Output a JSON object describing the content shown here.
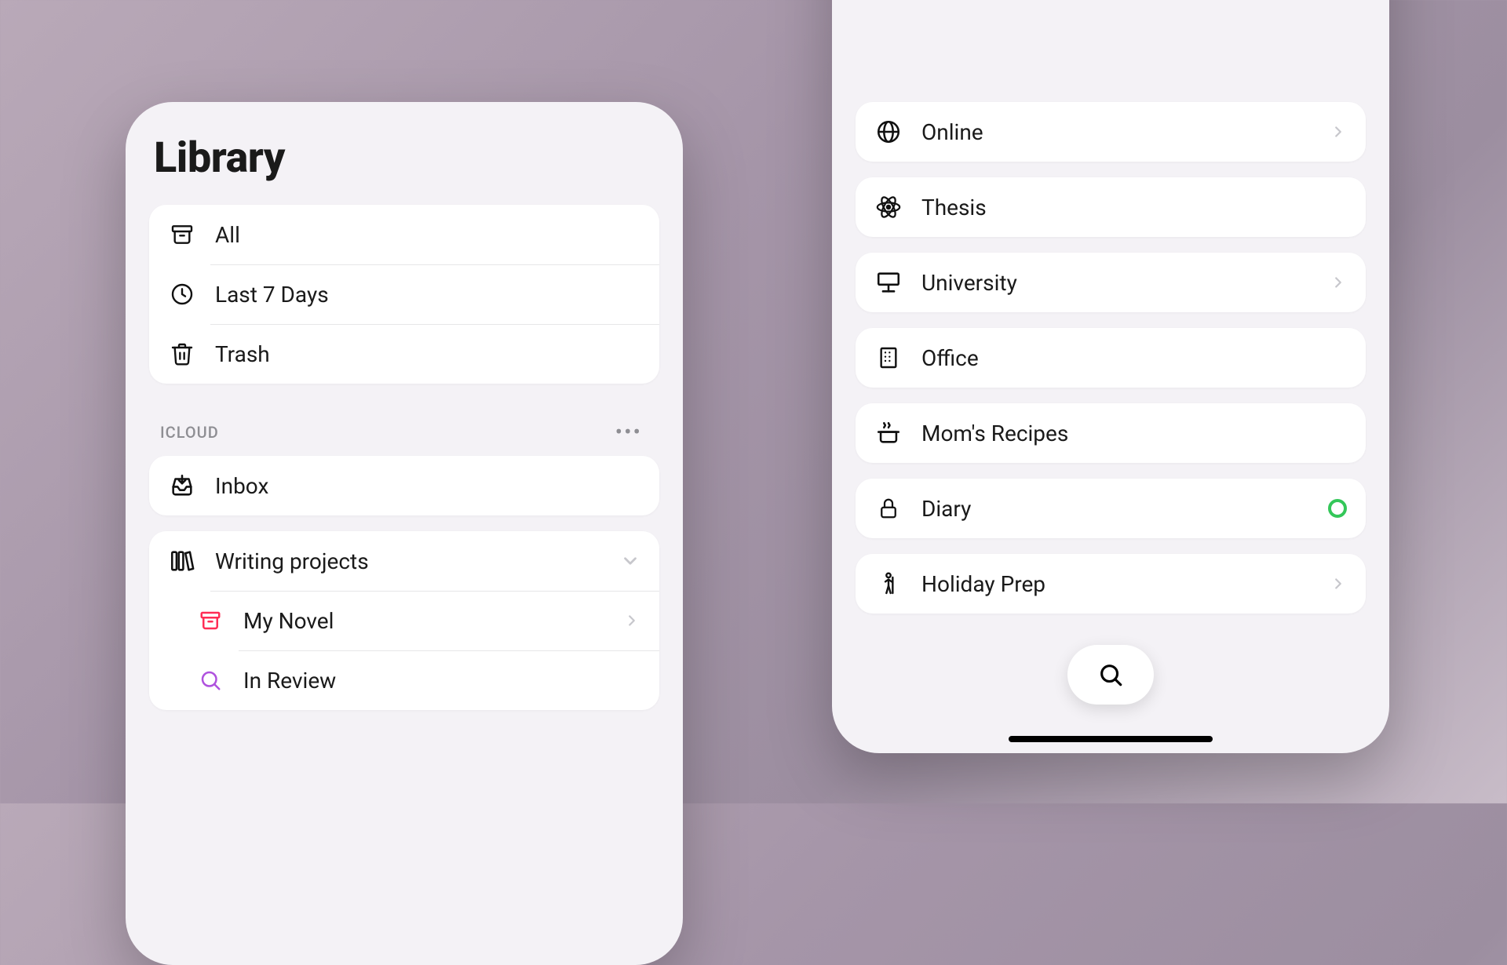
{
  "left": {
    "title": "Library",
    "system_items": [
      {
        "icon": "archive",
        "label": "All"
      },
      {
        "icon": "clock",
        "label": "Last 7 Days"
      },
      {
        "icon": "trash",
        "label": "Trash"
      }
    ],
    "cloud_section": {
      "header": "ICLOUD",
      "inbox_label": "Inbox",
      "group_label": "Writing projects",
      "children": [
        {
          "icon": "archive",
          "label": "My Novel",
          "color": "accent",
          "chevron": true
        },
        {
          "icon": "search",
          "label": "In Review",
          "color": "purple",
          "chevron": false
        }
      ]
    }
  },
  "right": {
    "items": [
      {
        "icon": "globe",
        "label": "Online",
        "chevron": true
      },
      {
        "icon": "atom",
        "label": "Thesis"
      },
      {
        "icon": "presentation",
        "label": "University",
        "chevron": true
      },
      {
        "icon": "building",
        "label": "Office"
      },
      {
        "icon": "pot",
        "label": "Mom's Recipes"
      },
      {
        "icon": "lock",
        "label": "Diary",
        "status": true
      },
      {
        "icon": "hiker",
        "label": "Holiday Prep",
        "chevron": true
      }
    ]
  }
}
